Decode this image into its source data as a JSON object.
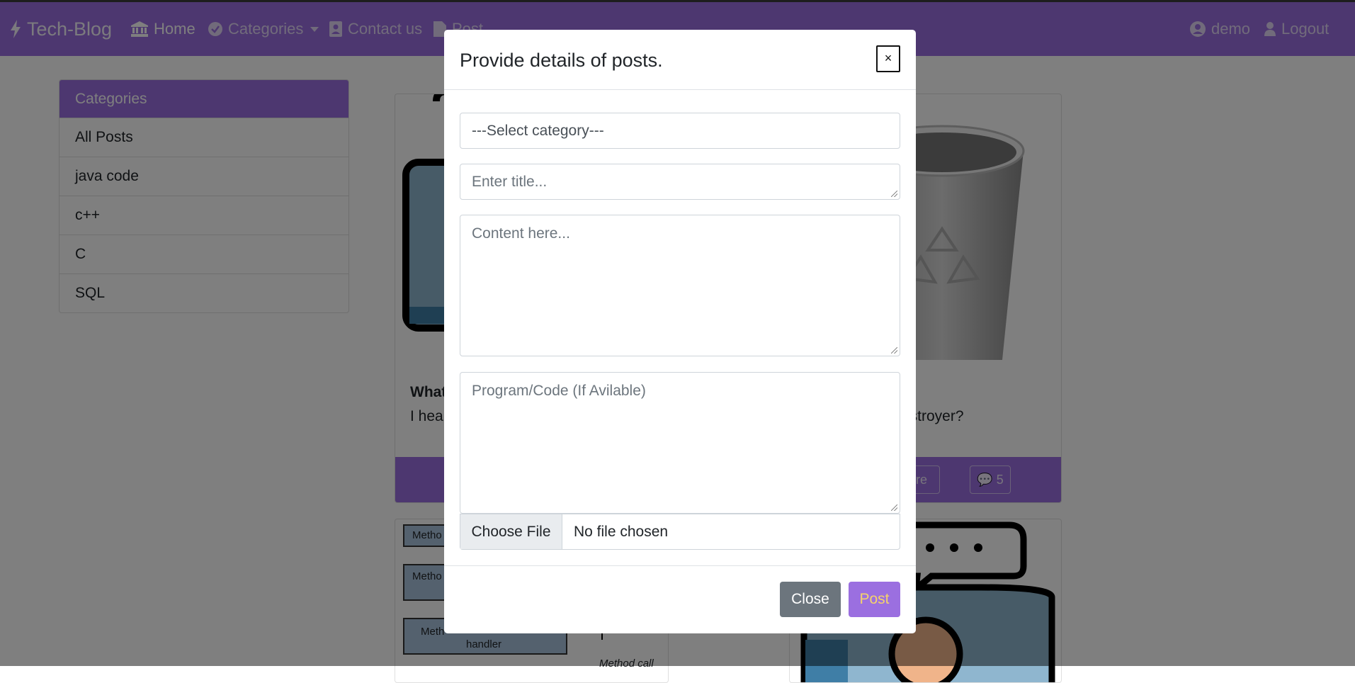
{
  "navbar": {
    "brand": "Tech-Blog",
    "home": "Home",
    "categories": "Categories",
    "contact": "Contact us",
    "post": "Post",
    "user": "demo",
    "logout": "Logout"
  },
  "sidebar": {
    "header": "Categories",
    "items": [
      "All Posts",
      "java code",
      "c++",
      "C",
      "SQL"
    ]
  },
  "cards": {
    "card1": {
      "title_partial": "What",
      "text_partial": "I hea"
    },
    "card2": {
      "text_partial": "estroyer?",
      "read_more_partial": "d more",
      "comment_count": "5"
    },
    "card3": {
      "diagram_labels": [
        "Metho",
        "Metho",
        "Meth",
        "handler",
        "Method call"
      ]
    }
  },
  "modal": {
    "title": "Provide details of posts.",
    "close_icon": "×",
    "select_category": "---Select category---",
    "title_placeholder": "Enter title...",
    "content_placeholder": "Content here...",
    "code_placeholder": "Program/Code (If Avilable)",
    "choose_file": "Choose File",
    "no_file": "No file chosen",
    "close_button": "Close",
    "post_button": "Post"
  },
  "colors": {
    "primary": "#9b6fe0",
    "secondary_button": "#6c757d",
    "post_text": "#f5d36a"
  }
}
